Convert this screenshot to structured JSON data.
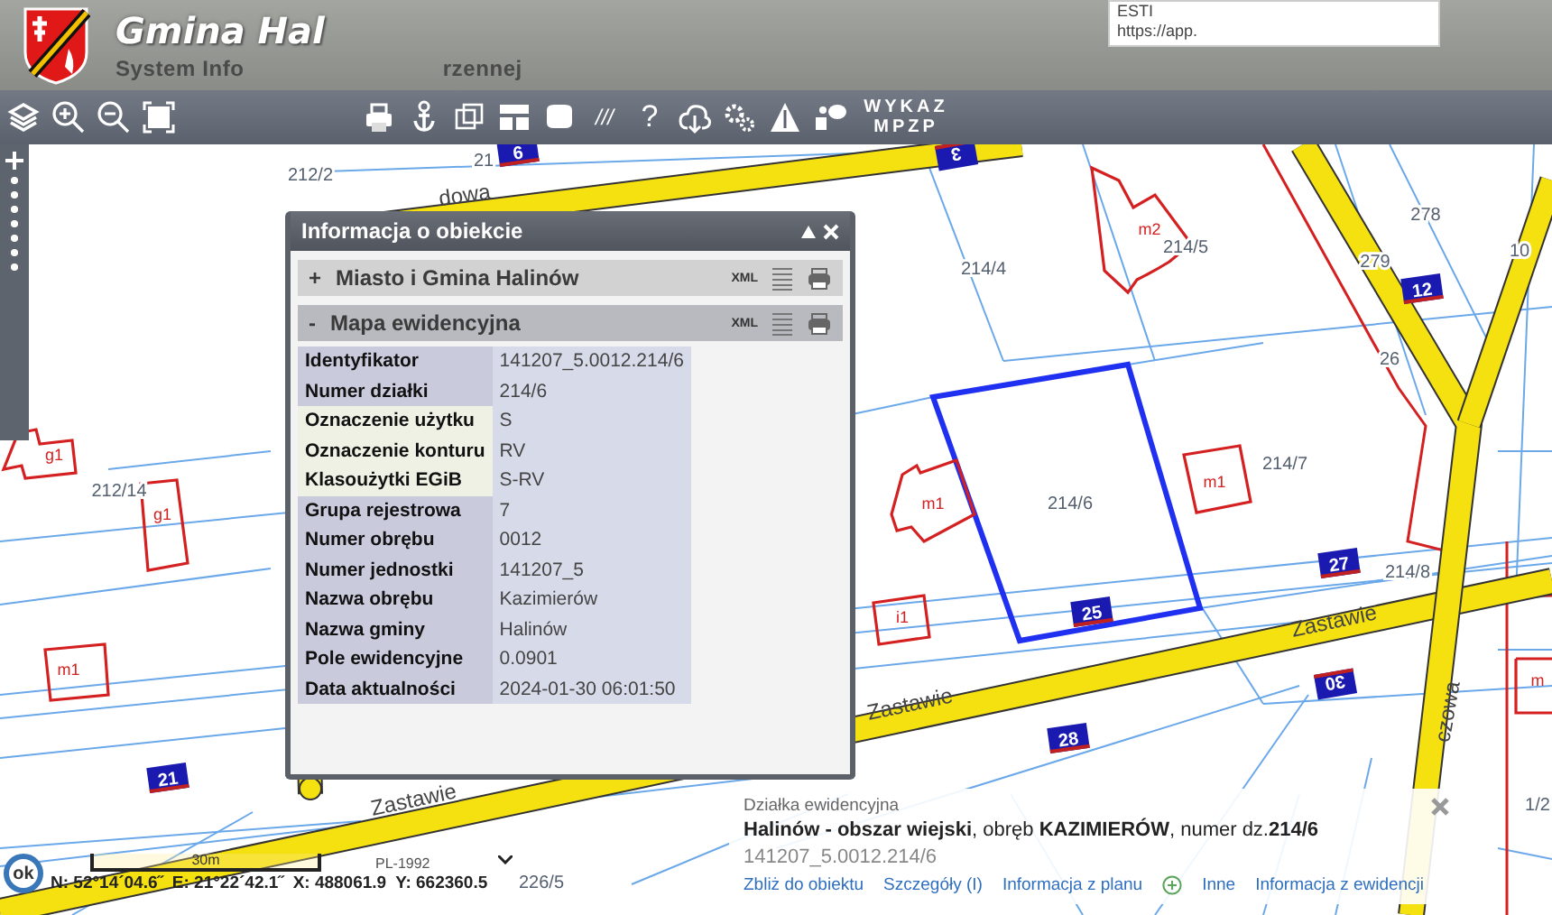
{
  "header": {
    "title": "Gmina Hal",
    "subtitle_parts": [
      "System Info",
      "rzennej"
    ]
  },
  "browser_tooltip": {
    "line_1": "ESTI",
    "line_2": "https://app."
  },
  "toolbar": {
    "help_glyph": "?",
    "hatch_glyph": "///",
    "wykaz_button": "WYKAZ MPZP"
  },
  "map": {
    "street_labels": [
      "dowa",
      "Zastawie",
      "Zastawie",
      "Zastawie",
      "czowa"
    ],
    "parcel_labels": [
      "212/2",
      "21",
      "214/4",
      "214/5",
      "278",
      "279",
      "10",
      "26",
      "214/6",
      "214/7",
      "214/8",
      "212/14",
      "226/5",
      "1/2"
    ],
    "house_numbers": [
      {
        "number": "6",
        "flipped": false
      },
      {
        "number": "3",
        "flipped": true
      },
      {
        "number": "12",
        "flipped": false
      },
      {
        "number": "27",
        "flipped": false
      },
      {
        "number": "25",
        "flipped": false
      },
      {
        "number": "30",
        "flipped": true
      },
      {
        "number": "28",
        "flipped": false
      },
      {
        "number": "21",
        "flipped": false
      }
    ],
    "building_labels": [
      "m2",
      "m1",
      "m1",
      "i1",
      "g1",
      "g1",
      "m1",
      "m"
    ]
  },
  "info_panel": {
    "title": "Informacja o obiekcie",
    "sections": [
      {
        "toggle": "+",
        "label": "Miasto i Gmina Halinów",
        "xml_label": "XML",
        "expanded": false
      },
      {
        "toggle": "-",
        "label": "Mapa ewidencyjna",
        "xml_label": "XML",
        "expanded": true,
        "rows": [
          {
            "label": "Identyfikator",
            "value": "141207_5.0012.214/6",
            "highlighted": false
          },
          {
            "label": "Numer działki",
            "value": "214/6",
            "highlighted": false
          },
          {
            "label": "Oznaczenie użytku",
            "value": "S",
            "highlighted": true
          },
          {
            "label": "Oznaczenie konturu",
            "value": "RV",
            "highlighted": true
          },
          {
            "label": "Klasoużytki EGiB",
            "value": "S-RV",
            "highlighted": true
          },
          {
            "label": "Grupa rejestrowa",
            "value": "7",
            "highlighted": false
          },
          {
            "label": "Numer obrębu",
            "value": "0012",
            "highlighted": false
          },
          {
            "label": "Numer jednostki",
            "value": "141207_5",
            "highlighted": false
          },
          {
            "label": "Nazwa obrębu",
            "value": "Kazimierów",
            "highlighted": false
          },
          {
            "label": "Nazwa gminy",
            "value": "Halinów",
            "highlighted": false
          },
          {
            "label": "Pole ewidencyjne",
            "value": "0.0901",
            "highlighted": false
          },
          {
            "label": "Data aktualności",
            "value": "2024-01-30 06:01:50",
            "highlighted": false
          }
        ]
      }
    ]
  },
  "popup": {
    "heading": "Działka ewidencyjna",
    "description": "**Halinów - obszar wiejski**, obręb **KAZIMIERÓW**, numer dz.**214/6**",
    "identifier": "141207_5.0012.214/6",
    "links": [
      "Zbliż do obiektu",
      "Szczegóły (I)",
      "Informacja z planu"
    ],
    "more_links": [
      "Inne",
      "Informacja z ewidencji"
    ]
  },
  "status": {
    "ok_button": "ok",
    "scale_label": "30m",
    "crs": "PL-1992",
    "coordinates": [
      "N: 52°14´04.6˝",
      "E: 21°22´42.1˝",
      "X: 488061.9",
      "Y: 662360.5"
    ]
  }
}
